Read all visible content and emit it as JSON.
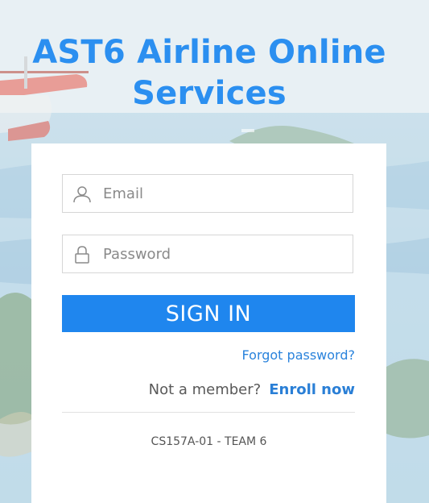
{
  "page": {
    "title": "AST6 Airline Online Services"
  },
  "login": {
    "email_placeholder": "Email",
    "email_value": "",
    "password_placeholder": "Password",
    "password_value": "",
    "sign_in_label": "SIGN IN",
    "forgot_password_label": "Forgot password?",
    "not_member_text": "Not a member?",
    "enroll_label": "Enroll now"
  },
  "footer": {
    "text": "CS157A-01 - TEAM 6"
  },
  "icons": {
    "email": "user-icon",
    "password": "lock-icon"
  },
  "colors": {
    "title": "#2b8ff0",
    "primary_button": "#1f86ee",
    "link": "#2a83dc"
  }
}
